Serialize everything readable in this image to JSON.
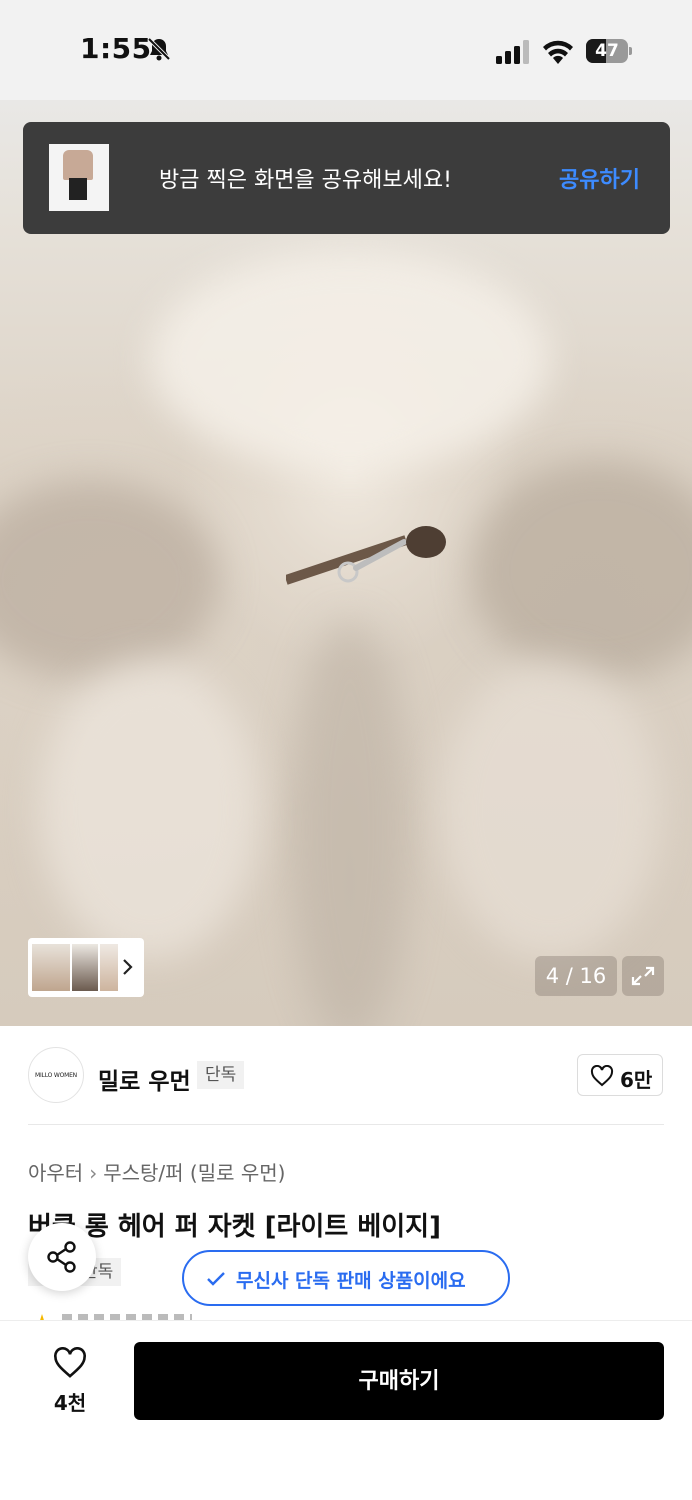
{
  "status_bar": {
    "time": "1:55",
    "battery_level": "47",
    "icons": [
      "bell-off-icon",
      "signal-icon",
      "wifi-icon",
      "battery-icon"
    ]
  },
  "share_toast": {
    "message": "방금 찍은 화면을 공유해보세요!",
    "action_label": "공유하기"
  },
  "gallery": {
    "counter": "4 / 16",
    "current": 4,
    "total": 16
  },
  "brand": {
    "logo_text": "MILLO WOMEN",
    "name": "밀로 우먼",
    "badge": "단독",
    "likes": "6만"
  },
  "product": {
    "breadcrumb": [
      "아우터",
      "무스탕/퍼 (밀로 우먼)"
    ],
    "title": "버클 롱 헤어 퍼 자켓 [라이트 베이지]",
    "tag": "단독",
    "exclusive_notice": "무신사 단독 판매 상품이에요"
  },
  "bottom_bar": {
    "wish_count": "4천",
    "buy_label": "구매하기"
  },
  "colors": {
    "accent_blue": "#2a6cf0",
    "toast_link": "#3d8bff",
    "toast_bg": "#3c3c3c",
    "buy_bg": "#000000"
  }
}
